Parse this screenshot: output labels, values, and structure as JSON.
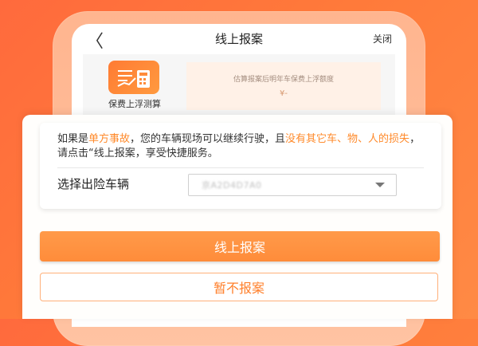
{
  "nav": {
    "back_glyph": "〈",
    "title": "线上报案",
    "close": "关闭"
  },
  "feature": {
    "label": "保费上浮测算",
    "icon": "chart-calculator-icon"
  },
  "estimate": {
    "line1": "估算报案后明年车保费上浮额度",
    "line2": "¥-"
  },
  "dialog": {
    "message_parts": [
      {
        "text": "如果是",
        "highlight": false
      },
      {
        "text": "单方事故",
        "highlight": true
      },
      {
        "text": "，您的车辆现场可以继续行驶，且",
        "highlight": false
      },
      {
        "text": "没有其它车、物、人的损失",
        "highlight": true
      },
      {
        "text": "，请点击“线上报案，享受快捷服务。",
        "highlight": false
      }
    ],
    "vehicle_label": "选择出险车辆",
    "vehicle_value": "京A2D4D7A0"
  },
  "buttons": {
    "primary": "线上报案",
    "secondary": "暂不报案"
  },
  "colors": {
    "accent": "#ff8a2b",
    "background": "#ff7a3a",
    "button_primary": "#ff9147"
  }
}
